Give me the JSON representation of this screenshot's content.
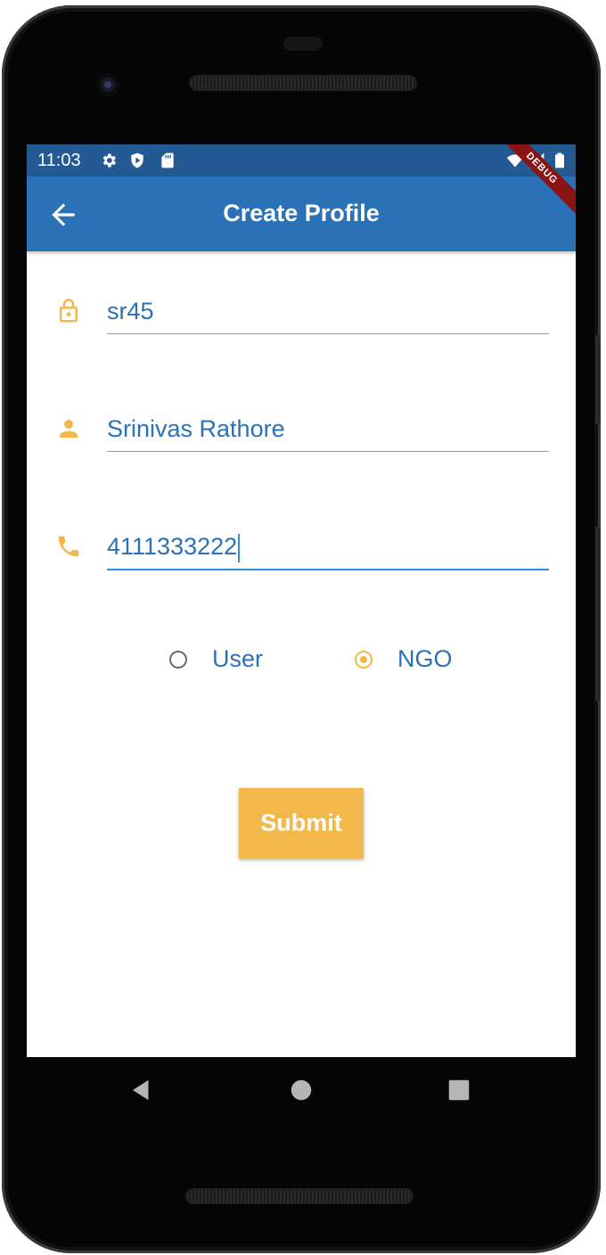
{
  "status_bar": {
    "time": "11:03",
    "icons": [
      "settings-icon",
      "shield-icon",
      "sd-card-icon",
      "wifi-icon",
      "signal-icon",
      "battery-icon"
    ]
  },
  "app_bar": {
    "title": "Create Profile",
    "back_icon": "arrow-back-icon",
    "debug_banner": "DEBUG"
  },
  "form": {
    "fields": [
      {
        "icon": "lock-icon",
        "value": "sr45"
      },
      {
        "icon": "person-icon",
        "value": "Srinivas Rathore"
      },
      {
        "icon": "phone-icon",
        "value": "4111333222",
        "focused": true
      }
    ],
    "role": {
      "options": [
        "User",
        "NGO"
      ],
      "selected": "NGO"
    },
    "submit_label": "Submit"
  },
  "nav_bar": {
    "icons": [
      "nav-back-icon",
      "nav-home-icon",
      "nav-recents-icon"
    ]
  },
  "colors": {
    "primary": "#2b71b6",
    "status_bar": "#235a93",
    "accent": "#f2b84b",
    "focus_underline": "#2f8fdc"
  }
}
